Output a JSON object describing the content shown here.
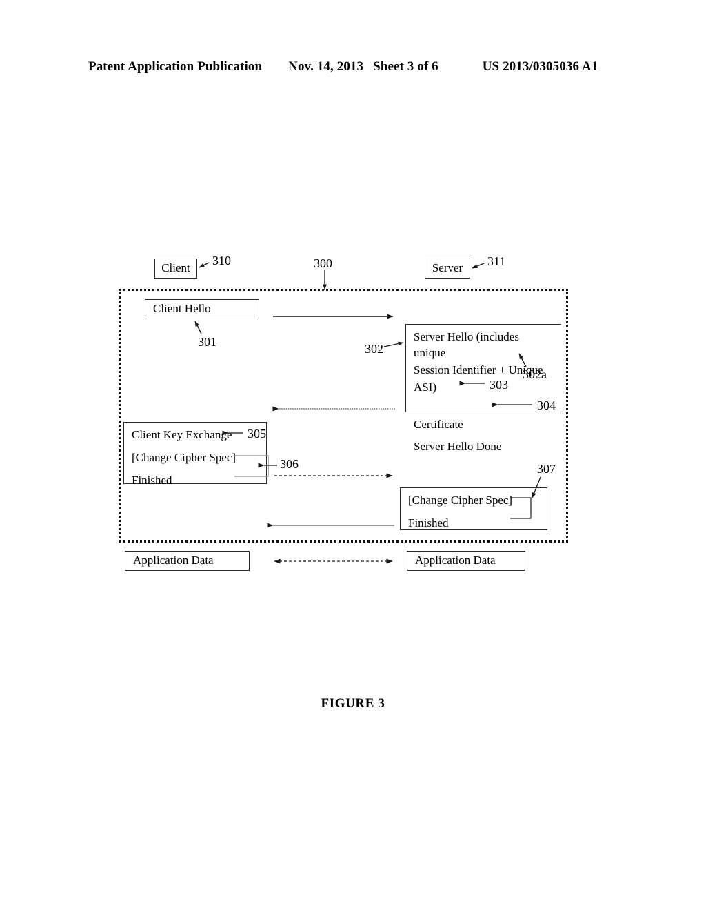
{
  "header": {
    "publication": "Patent Application Publication",
    "date": "Nov. 14, 2013",
    "sheet": "Sheet 3 of 6",
    "patent_number": "US 2013/0305036 A1"
  },
  "figure": {
    "caption": "FIGURE 3"
  },
  "diagram": {
    "endpoints": {
      "client": "Client",
      "server": "Server"
    },
    "messages": {
      "client_hello": "Client Hello",
      "server_hello_line1": "Server Hello (includes unique",
      "server_hello_line2": "Session Identifier + Unique",
      "server_hello_line3": "ASI)",
      "certificate": "Certificate",
      "server_hello_done": "Server Hello Done",
      "client_key_exchange": "Client Key Exchange",
      "change_cipher_spec_client": "[Change Cipher Spec]",
      "finished_client": "Finished",
      "change_cipher_spec_server": "[Change Cipher Spec]",
      "finished_server": "Finished",
      "application_data_client": "Application Data",
      "application_data_server": "Application Data"
    },
    "reference_numerals": {
      "secure_channel": "300",
      "client_hello": "301",
      "server_hello": "302",
      "unique_asi": "302a",
      "certificate": "303",
      "server_hello_done": "304",
      "client_key_exchange": "305",
      "client_cipher_group": "306",
      "server_cipher_group": "307",
      "client_endpoint": "310",
      "server_endpoint": "311"
    }
  }
}
